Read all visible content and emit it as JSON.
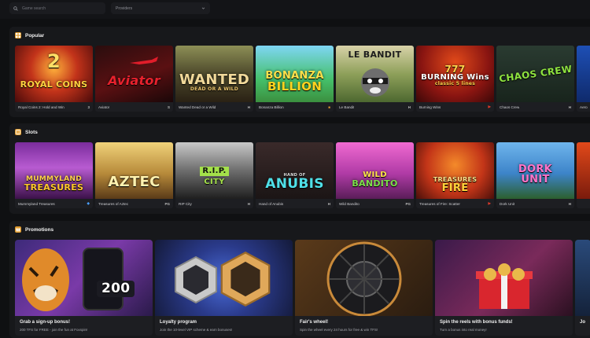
{
  "search": {
    "placeholder": "Game search"
  },
  "filters": {
    "providers_label": "Providers"
  },
  "sections": {
    "popular": {
      "title": "Popular",
      "games": [
        {
          "name": "Royal Coins 2: Hold and Win",
          "art_title": "ROYAL COINS",
          "badge": "2",
          "provider_mark": "3"
        },
        {
          "name": "Aviator",
          "art_title": "Aviator",
          "provider_mark": "S"
        },
        {
          "name": "Wanted Dead or a Wild",
          "art_title": "WANTED",
          "art_sub": "DEAD OR A WILD",
          "provider_mark": "H"
        },
        {
          "name": "Bonanza Billion",
          "art_title": "BONANZA",
          "art_sub": "BILLION",
          "provider_mark": "■"
        },
        {
          "name": "Le Bandit",
          "art_title": "LE BANDIT",
          "provider_mark": "H"
        },
        {
          "name": "Burning Wins",
          "art_title": "BURNING Wins",
          "art_sub": "classic 5 lines",
          "badge": "777",
          "provider_mark": "▶"
        },
        {
          "name": "Chaos Crew",
          "art_title": "CHAOS CREW",
          "provider_mark": "H"
        },
        {
          "name": "Aero",
          "art_title": "",
          "provider_mark": ""
        }
      ]
    },
    "slots": {
      "title": "Slots",
      "games": [
        {
          "name": "Mummyland Treasures",
          "art_title": "MUMMYLAND",
          "art_sub": "TREASURES",
          "provider_mark": "◆"
        },
        {
          "name": "Treasures of Aztec",
          "art_title": "AZTEC",
          "provider_mark": "PG"
        },
        {
          "name": "RIP City",
          "art_title": "R.I.P.",
          "art_sub": "CITY",
          "provider_mark": "H"
        },
        {
          "name": "Hand of Anubis",
          "art_title": "ANUBIS",
          "art_sub": "HAND OF",
          "provider_mark": "H"
        },
        {
          "name": "Wild Bandito",
          "art_title": "WILD",
          "art_sub": "BANDITO",
          "provider_mark": "PG"
        },
        {
          "name": "Treasures of Fire: Scatter",
          "art_title": "TREASURES",
          "art_sub": "FIRE",
          "provider_mark": "▶"
        },
        {
          "name": "Dork Unit",
          "art_title": "DORK",
          "art_sub": "UNIT",
          "provider_mark": "H"
        },
        {
          "name": "",
          "art_title": "",
          "provider_mark": ""
        }
      ]
    },
    "promotions": {
      "title": "Promotions",
      "items": [
        {
          "title": "Grab a sign-up bonus!",
          "desc": "200 TFS for FREE - join the fun at Foxspin!",
          "art_text": "200"
        },
        {
          "title": "Loyalty program",
          "desc": "Join the 10-level VIP scheme & earn bonuses!"
        },
        {
          "title": "Fair's wheel!",
          "desc": "Spin the wheel every 24 hours for free & win TFS!"
        },
        {
          "title": "Spin the reels with bonus funds!",
          "desc": "Turn a bonus into real money!"
        },
        {
          "title": "Jo",
          "desc": ""
        }
      ]
    }
  },
  "colors": {
    "accent": "#e09b2d",
    "bg": "#0f1012",
    "panel": "#17181b"
  }
}
